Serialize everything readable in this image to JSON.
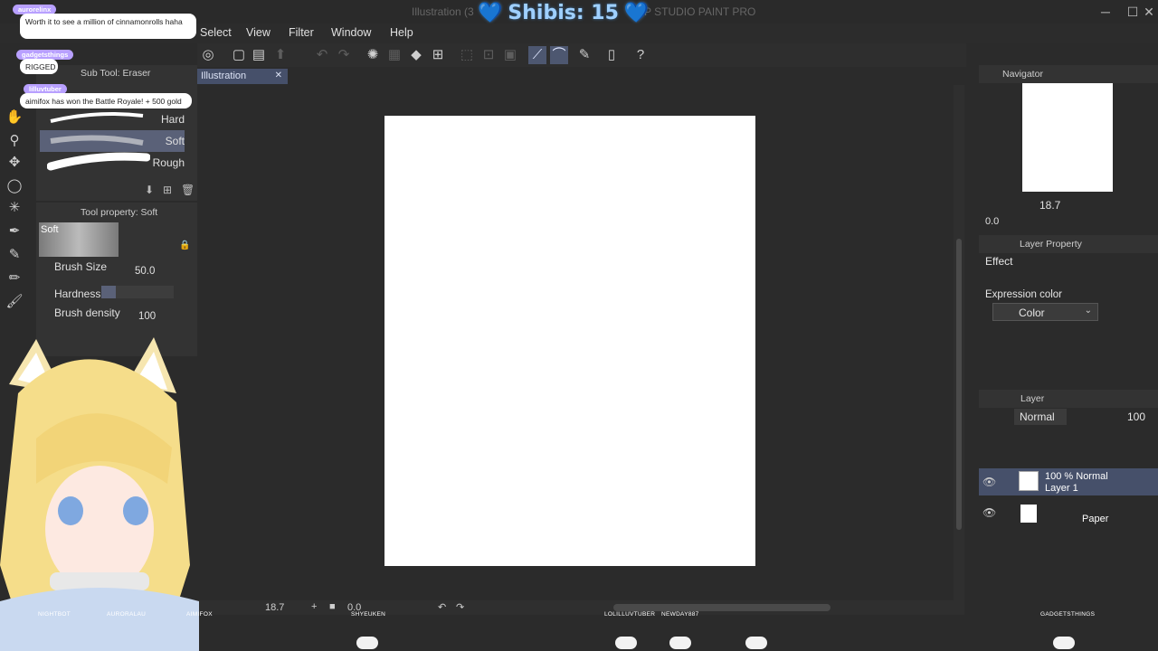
{
  "window": {
    "title_left": "Illustration (3",
    "title_right": "P STUDIO PAINT PRO",
    "controls": [
      "─",
      "☐",
      "✕"
    ]
  },
  "overlay": {
    "counter_label": "Shibis: 15",
    "heart_glyph": "💙"
  },
  "menu": {
    "items": [
      "Select",
      "View",
      "Filter",
      "Window",
      "Help"
    ]
  },
  "subtool": {
    "header": "Sub Tool: Eraser",
    "brushes": [
      {
        "label": "Hard"
      },
      {
        "label": "Soft",
        "selected": true
      },
      {
        "label": "Rough"
      }
    ]
  },
  "tool_property": {
    "header": "Tool property: Soft",
    "preset_name": "Soft",
    "brush_size_label": "Brush Size",
    "brush_size_value": "50.0",
    "hardness_label": "Hardness",
    "hardness_level": 0.2,
    "brush_density_label": "Brush density",
    "brush_density_value": "100"
  },
  "document": {
    "tab_label": "Illustration",
    "tab_close": "✕"
  },
  "bottom_bar": {
    "zoom": "18.7",
    "rotation": "0.0"
  },
  "navigator": {
    "header": "Navigator",
    "zoom": "18.7",
    "rotation": "0.0"
  },
  "layer_property": {
    "header": "Layer Property",
    "effect_label": "Effect",
    "expression_color_label": "Expression color",
    "expression_color_value": "Color"
  },
  "layer_panel": {
    "header": "Layer",
    "blend_mode": "Normal",
    "opacity": "100",
    "layers": [
      {
        "line1": "100 % Normal",
        "line2": "Layer 1",
        "selected": true
      },
      {
        "line1": "",
        "line2": "Paper",
        "selected": false
      }
    ]
  },
  "chat": {
    "messages": [
      {
        "name": "aurorelinx",
        "text": "Worth it to see a million of cinnamonrolls haha"
      },
      {
        "name": "gadgetsthings",
        "text": "RIGGED"
      },
      {
        "name": "lilluvtuber",
        "text": "aimifox has won the Battle Royale! + 500 gold"
      }
    ]
  },
  "stream_names": [
    "NIGHTBOT",
    "AURORALAU",
    "AIMIFOX",
    "SHYEUKEN",
    "LOLILLUVTUBER",
    "NEWDAY887",
    "GADGETSTHINGS"
  ],
  "colors": {
    "accent": "#4d5770",
    "panel_bg": "#333333",
    "app_bg": "#2b2b2b",
    "counter": "#9fd0ff",
    "chat_badge": "#b8a0ff"
  }
}
